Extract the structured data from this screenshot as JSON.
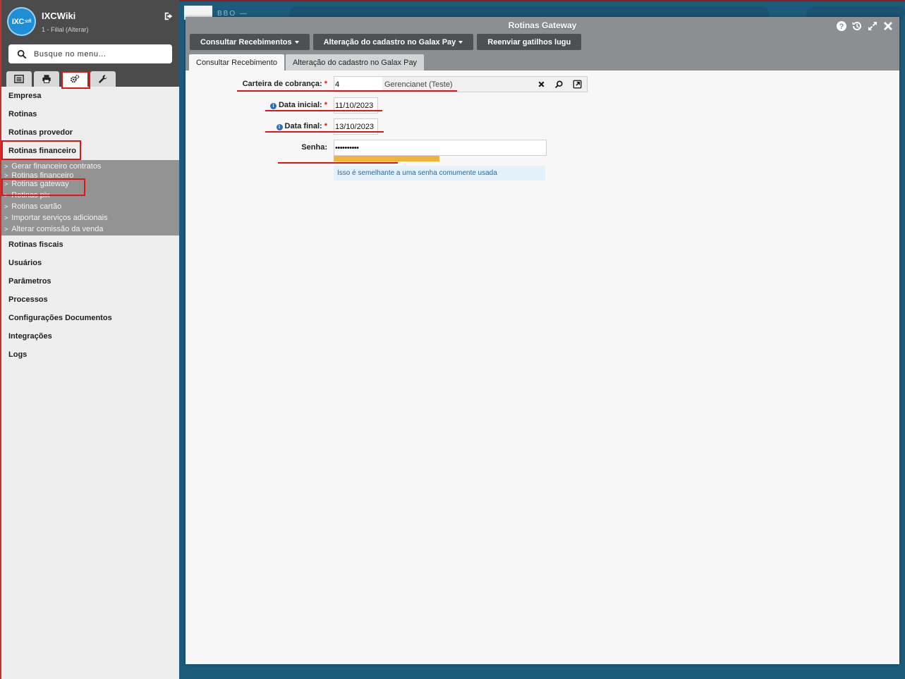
{
  "sidebar": {
    "app_title": "IXCWiki",
    "branch": "1 - Filial (Alterar)",
    "logo_text": "IXC",
    "logo_sub": "soft",
    "search_placeholder": "Busque no menu...",
    "tabs": [
      {
        "icon": "list-icon"
      },
      {
        "icon": "print-icon"
      },
      {
        "icon": "gears-icon"
      },
      {
        "icon": "wrench-icon"
      }
    ],
    "menu": {
      "empresa": "Empresa",
      "rotinas": "Rotinas",
      "rotinas_provedor": "Rotinas provedor",
      "rotinas_financeiro": "Rotinas financeiro",
      "sub": [
        "Gerar financeiro contratos",
        "Rotinas financeiro",
        "Rotinas gateway",
        "Rotinas pix",
        "Rotinas cartão",
        "Importar serviços adicionais",
        "Alterar comissão da venda"
      ],
      "rotinas_fiscais": "Rotinas fiscais",
      "usuarios": "Usuários",
      "parametros": "Parâmetros",
      "processos": "Processos",
      "configuracoes": "Configurações Documentos",
      "integracoes": "Integrações",
      "logs": "Logs"
    }
  },
  "background": {
    "stub_text": "BBO —"
  },
  "window": {
    "title": "Rotinas Gateway",
    "toolbar": {
      "consultar": "Consultar Recebimentos",
      "alteracao": "Alteração do cadastro no Galax Pay",
      "reenviar": "Reenviar gatilhos lugu"
    },
    "tabs": {
      "tab1": "Consultar Recebimento",
      "tab2": "Alteração do cadastro no Galax Pay"
    },
    "form": {
      "carteira_label": "Carteira de cobrança:",
      "carteira_code": "4",
      "carteira_desc": "Gerencianet (Teste)",
      "data_inicial_label": "Data inicial:",
      "data_inicial_value": "11/10/2023",
      "data_final_label": "Data final:",
      "data_final_value": "13/10/2023",
      "senha_label": "Senha:",
      "senha_value": "••••••••••",
      "senha_hint": "Isso é semelhante a uma senha comumente usada",
      "required_mark": "*",
      "info_mark": "i"
    }
  },
  "colors": {
    "highlight": "#e01515",
    "titlebar": "#8c8f91",
    "toolbar_button": "#4e5154",
    "strength_bar": "#f0b43a"
  }
}
